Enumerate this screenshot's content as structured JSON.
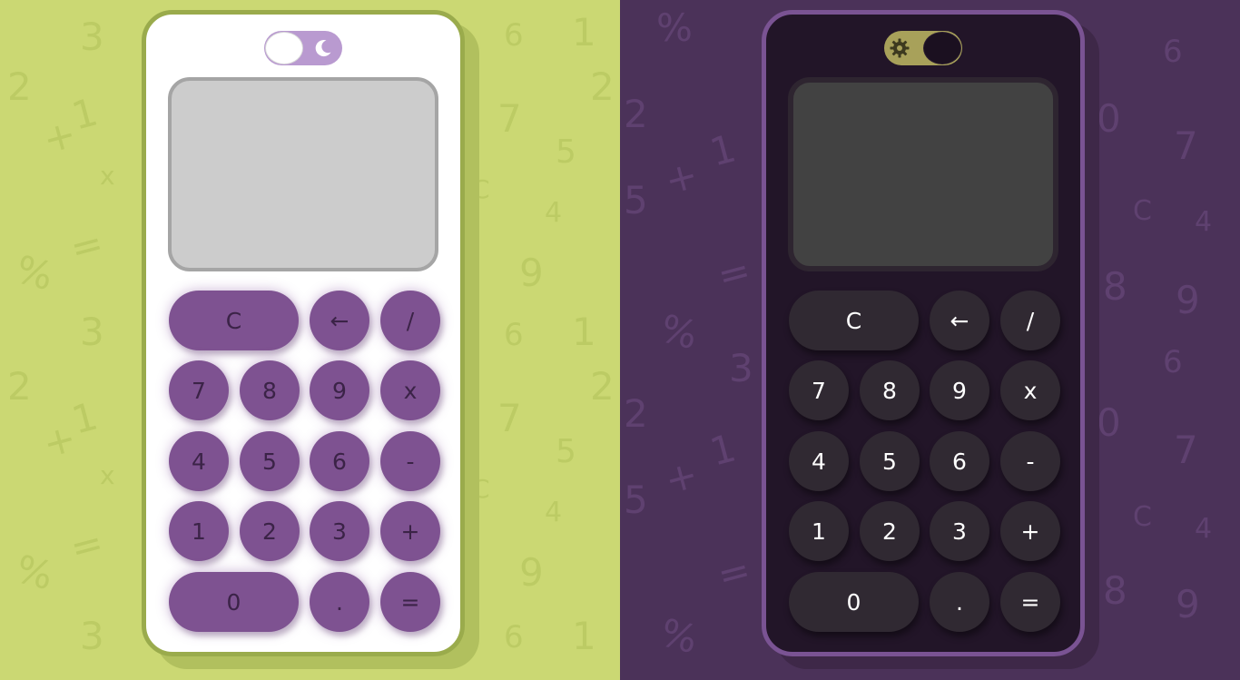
{
  "colors": {
    "light_bg": "#cbd873",
    "dark_bg": "#4b3259",
    "light_key": "#7e5291",
    "dark_key": "#302932",
    "light_display": "#cccccc",
    "dark_display": "#424242"
  },
  "background_glyphs": [
    "3",
    "2",
    "+",
    "1",
    "x",
    "=",
    "%",
    "6",
    "1",
    "7",
    "5",
    "C",
    "4",
    "9",
    "0",
    ".",
    "-",
    "8",
    "2",
    "5",
    "7",
    "6",
    "9"
  ],
  "light_theme": {
    "toggle_icon": "moon-icon",
    "display_value": "",
    "keys": [
      "C",
      "←",
      "/",
      "7",
      "8",
      "9",
      "x",
      "4",
      "5",
      "6",
      "-",
      "1",
      "2",
      "3",
      "+",
      "0",
      ".",
      "="
    ]
  },
  "dark_theme": {
    "toggle_icon": "gear-icon",
    "display_value": "",
    "keys": [
      "C",
      "←",
      "/",
      "7",
      "8",
      "9",
      "x",
      "4",
      "5",
      "6",
      "-",
      "1",
      "2",
      "3",
      "+",
      "0",
      ".",
      "="
    ]
  }
}
